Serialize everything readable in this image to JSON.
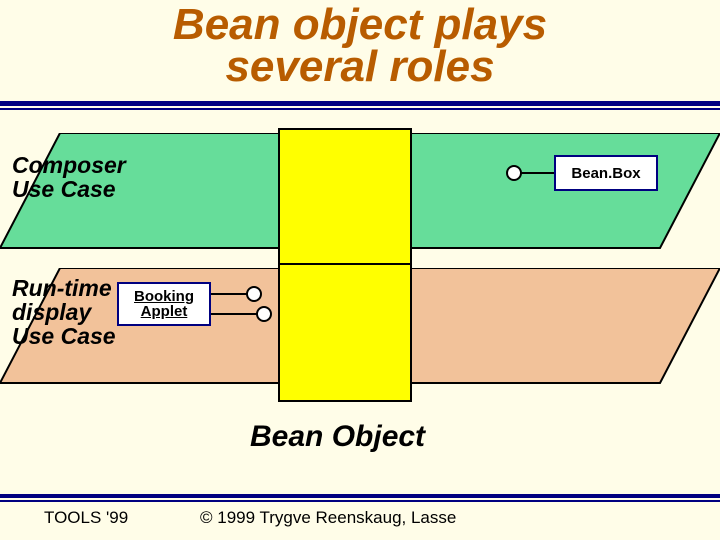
{
  "title_line1": "Bean object plays",
  "title_line2": "several roles",
  "plane1": {
    "label_line1": "Composer",
    "label_line2": "Use Case",
    "right_box": "Bean.Box"
  },
  "plane2": {
    "label_line1": "Run-time",
    "label_line2": "display",
    "label_line3": "Use Case",
    "left_box_line1": "Booking",
    "left_box_line2": "Applet"
  },
  "central_label": "Bean Object",
  "footer": {
    "left": "TOOLS '99",
    "center": "© 1999 Trygve Reenskaug, Lasse"
  },
  "colors": {
    "plane1_fill": "#66dd9a",
    "plane2_fill": "#f2c29a",
    "title_color": "#b85c00",
    "rule_color": "#000080"
  }
}
